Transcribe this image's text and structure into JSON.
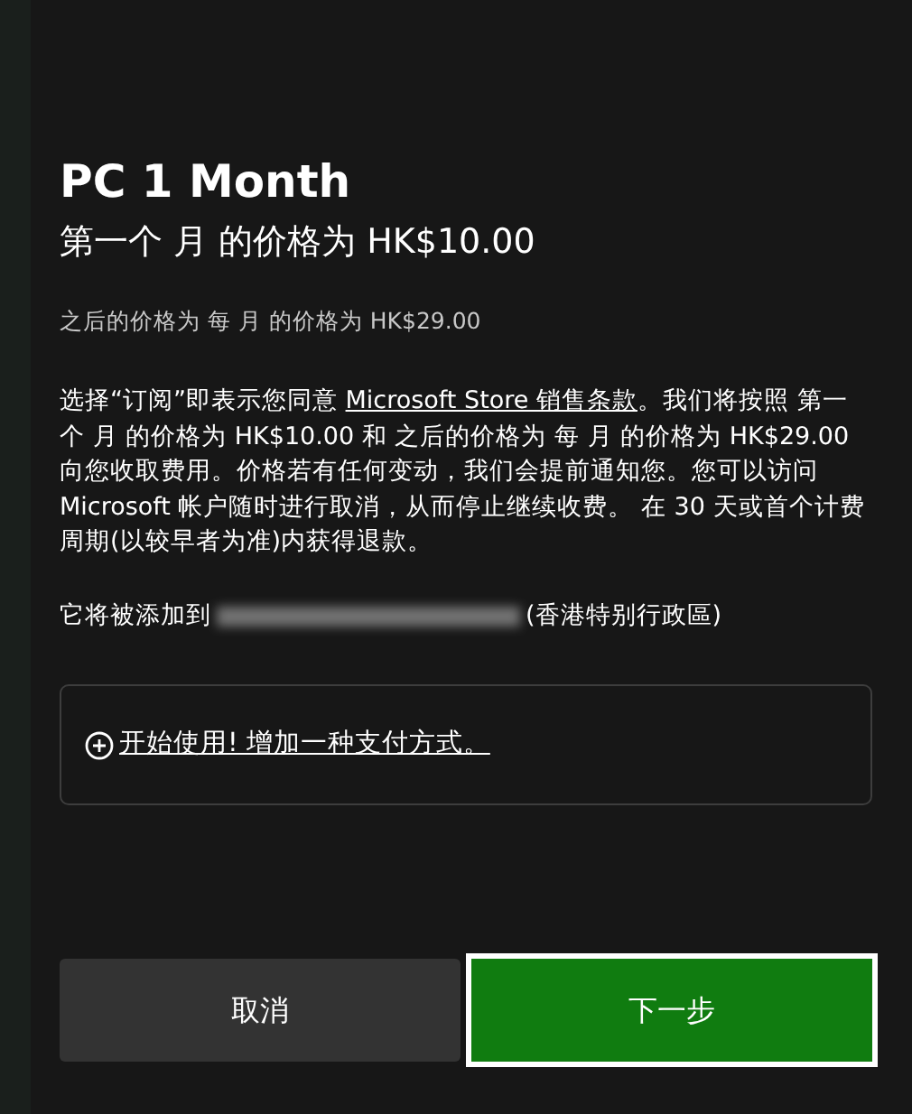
{
  "dialog": {
    "title": "PC 1 Month",
    "first_price": "第一个 月 的价格为 HK$10.00",
    "later_price": "之后的价格为 每 月 的价格为 HK$29.00",
    "terms": {
      "before": "选择“订阅”即表示您同意 ",
      "link": "Microsoft Store 销售条款",
      "after": "。我们将按照 第一个 月 的价格为 HK$10.00 和 之后的价格为 每 月 的价格为 HK$29.00 向您收取费用。价格若有任何变动，我们会提前通知您。您可以访问 Microsoft 帐户随时进行取消，从而停止继续收费。 在 30 天或首个计费周期(以较早者为准)内获得退款。"
    },
    "account": {
      "prefix": "它将被添加到",
      "email_blurred": true,
      "suffix": "(香港特别行政區)"
    },
    "payment_link": "开始使用! 增加一种支付方式。",
    "buttons": [
      {
        "label": "取消",
        "kind": "secondary",
        "focused": false
      },
      {
        "label": "下一步",
        "kind": "primary",
        "focused": true
      }
    ]
  }
}
